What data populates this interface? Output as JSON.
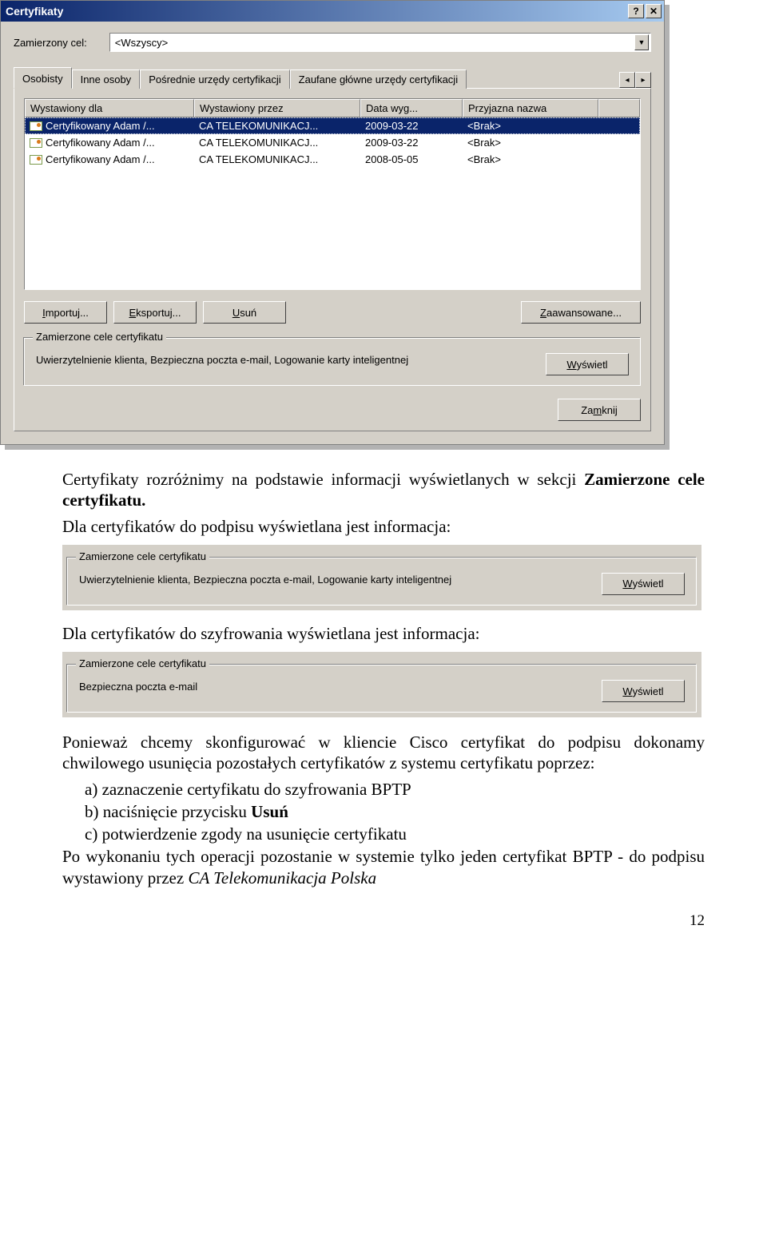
{
  "dialog": {
    "title": "Certyfikaty",
    "help_btn": "?",
    "close_btn": "✕",
    "purpose_label": "Zamierzony cel:",
    "purpose_value": "<Wszyscy>",
    "tabs": [
      "Osobisty",
      "Inne osoby",
      "Pośrednie urzędy certyfikacji",
      "Zaufane główne urzędy certyfikacji"
    ],
    "nav_left": "◂",
    "nav_right": "▸",
    "columns": [
      "Wystawiony dla",
      "Wystawiony przez",
      "Data wyg...",
      "Przyjazna nazwa"
    ],
    "rows": [
      {
        "c0": "Certyfikowany Adam /...",
        "c1": "CA TELEKOMUNIKACJ...",
        "c2": "2009-03-22",
        "c3": "<Brak>",
        "selected": true
      },
      {
        "c0": "Certyfikowany Adam /...",
        "c1": "CA TELEKOMUNIKACJ...",
        "c2": "2009-03-22",
        "c3": "<Brak>",
        "selected": false
      },
      {
        "c0": "Certyfikowany Adam /...",
        "c1": "CA TELEKOMUNIKACJ...",
        "c2": "2008-05-05",
        "c3": "<Brak>",
        "selected": false
      }
    ],
    "btn_import": "Importuj...",
    "btn_export": "Eksportuj...",
    "btn_delete": "Usuń",
    "btn_advanced": "Zaawansowane...",
    "group_label": "Zamierzone cele certyfikatu",
    "group_text": "Uwierzytelnienie klienta, Bezpieczna poczta e-mail, Logowanie karty inteligentnej",
    "btn_view": "Wyświetl",
    "btn_close": "Zamknij"
  },
  "signing_box": {
    "label": "Zamierzone cele certyfikatu",
    "text": "Uwierzytelnienie klienta, Bezpieczna poczta e-mail, Logowanie karty inteligentnej",
    "btn": "Wyświetl"
  },
  "encrypt_box": {
    "label": "Zamierzone cele certyfikatu",
    "text": "Bezpieczna poczta e-mail",
    "btn": "Wyświetl"
  },
  "doc": {
    "p1a": "Certyfikaty rozróżnimy na podstawie informacji wyświetlanych w sekcji ",
    "p1b": "Zamierzone cele certyfikatu.",
    "p2": "Dla certyfikatów do podpisu wyświetlana jest informacja:",
    "p3": "Dla certyfikatów do szyfrowania wyświetlana jest informacja:",
    "p4": "Ponieważ chcemy skonfigurować w kliencie Cisco certyfikat do podpisu dokonamy chwilowego usunięcia pozostałych certyfikatów z systemu certyfikatu poprzez:",
    "li_a": "a)  zaznaczenie certyfikatu do szyfrowania BPTP",
    "li_b_1": "b)  naciśnięcie przycisku ",
    "li_b_2": "Usuń",
    "li_c": "c)  potwierdzenie zgody na usunięcie certyfikatu",
    "p5a": "Po wykonaniu tych operacji pozostanie w systemie tylko jeden certyfikat BPTP - do podpisu wystawiony przez ",
    "p5b": "CA Telekomunikacja Polska",
    "pagenum": "12"
  }
}
